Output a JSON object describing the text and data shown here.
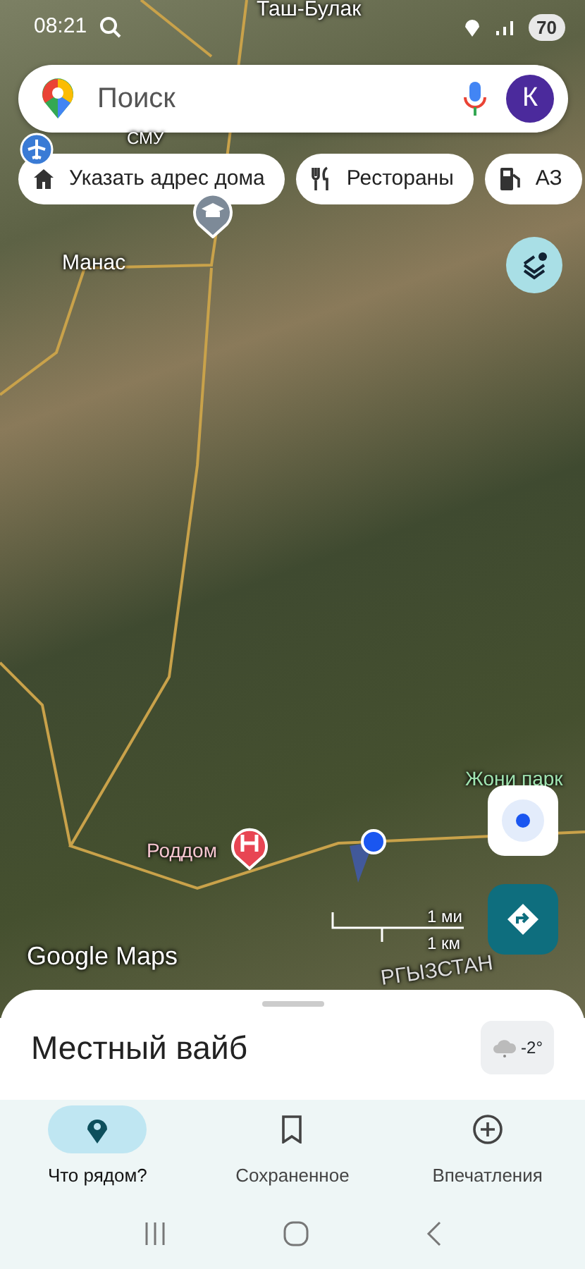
{
  "status_bar": {
    "time": "08:21",
    "battery": "70"
  },
  "search": {
    "placeholder": "Поиск",
    "avatar": "К"
  },
  "chips": [
    {
      "label": "Указать адрес дома",
      "kind": "home"
    },
    {
      "label": "Рестораны",
      "kind": "restaurant"
    },
    {
      "label": "АЗ",
      "kind": "fuel"
    }
  ],
  "map_labels": [
    {
      "text": "Таш-Булак",
      "kind": "place"
    },
    {
      "text": "СМУ",
      "kind": "place"
    },
    {
      "text": "Манас",
      "kind": "place"
    },
    {
      "text": "Роддом",
      "kind": "hospital"
    },
    {
      "text": "Жони парк",
      "kind": "park"
    },
    {
      "text": "РГЫЗСТАН",
      "kind": "region"
    }
  ],
  "scale": {
    "miles": "1 ми",
    "km": "1 км"
  },
  "attribution": "Google Maps",
  "sheet": {
    "title": "Местный вайб",
    "weather": "-2°"
  },
  "nav_tabs": [
    {
      "label": "Что рядом?",
      "selected": true,
      "kind": "pin"
    },
    {
      "label": "Сохраненное",
      "selected": false,
      "kind": "bookmark"
    },
    {
      "label": "Впечатления",
      "selected": false,
      "kind": "add"
    }
  ]
}
